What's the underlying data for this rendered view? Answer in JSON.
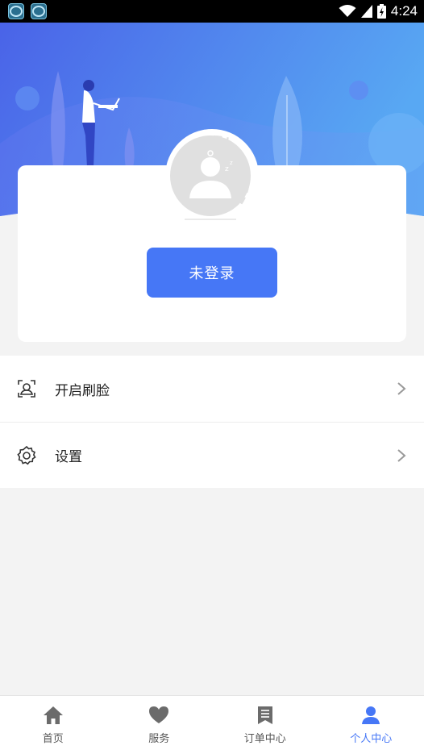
{
  "status_bar": {
    "time": "4:24"
  },
  "profile": {
    "login_label": "未登录"
  },
  "menu": [
    {
      "label": "开启刷脸",
      "icon": "face-scan-icon"
    },
    {
      "label": "设置",
      "icon": "gear-icon"
    }
  ],
  "tabs": [
    {
      "label": "首页",
      "icon": "home-icon",
      "active": false
    },
    {
      "label": "服务",
      "icon": "heart-icon",
      "active": false
    },
    {
      "label": "订单中心",
      "icon": "bookmark-icon",
      "active": false
    },
    {
      "label": "个人中心",
      "icon": "person-icon",
      "active": true
    }
  ],
  "colors": {
    "accent": "#4677f6",
    "hero_start": "#4a63e8",
    "hero_end": "#58a8f3"
  }
}
